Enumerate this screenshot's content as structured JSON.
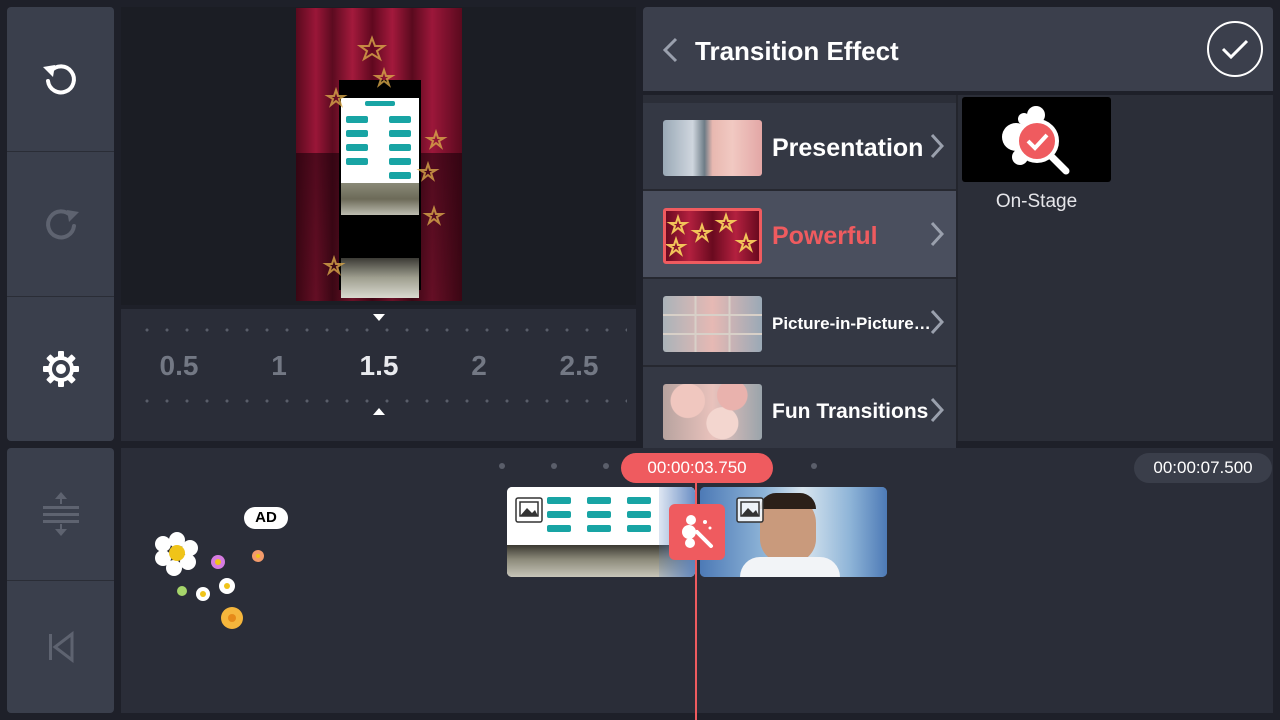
{
  "left_toolbar": {
    "undo_icon": "undo-icon",
    "redo_icon": "redo-icon",
    "settings_icon": "gear-icon",
    "expand_icon": "expand-tracks-icon",
    "rewind_icon": "skip-to-start-icon"
  },
  "speed_ruler": {
    "values": [
      "0.5",
      "1",
      "1.5",
      "2",
      "2.5"
    ],
    "selected": "1.5"
  },
  "transition_panel": {
    "title": "Transition Effect",
    "back_icon": "chevron-left-icon",
    "confirm_icon": "check-icon",
    "accent_color": "#ef5b5f",
    "categories": [
      {
        "label": "Presentation"
      },
      {
        "label": "Powerful"
      },
      {
        "label": "Picture-in-Picture…"
      },
      {
        "label": "Fun Transitions"
      }
    ],
    "selected_category": "Powerful",
    "effects": [
      {
        "label": "On-Stage",
        "selected": true
      }
    ]
  },
  "timeline": {
    "playhead_time": "00:00:03.750",
    "total_duration": "00:00:07.500",
    "ad_label": "AD",
    "clips": [
      {
        "type": "image",
        "icon": "image-icon"
      },
      {
        "type": "image",
        "icon": "image-icon"
      }
    ],
    "transition_icon": "transition-magic-icon"
  }
}
